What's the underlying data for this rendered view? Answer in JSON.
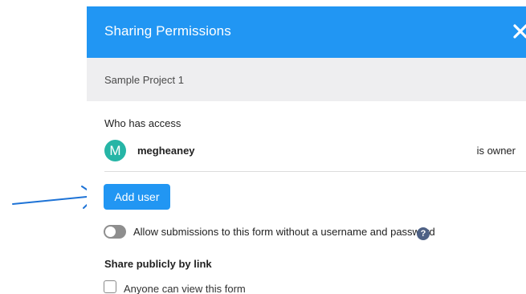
{
  "annotation": {
    "arrow_icon": "right-arrow-icon",
    "arrow_color": "#1e73d6"
  },
  "modal": {
    "title": "Sharing Permissions",
    "close_icon": "close-icon",
    "header_color": "#2196f3",
    "project_name": "Sample Project 1",
    "access_label": "Who has access",
    "users": [
      {
        "avatar_letter": "M",
        "avatar_color": "#26b5a6",
        "username": "megheaney",
        "role": "is owner"
      }
    ],
    "add_user_label": "Add user",
    "toggle": {
      "label": "Allow submissions to this form without a username and password",
      "enabled": false,
      "help_icon": "question-circle-icon",
      "help_glyph": "?"
    },
    "share_heading": "Share publicly by link",
    "public_view": {
      "label": "Anyone can view this form",
      "checked": false
    }
  }
}
